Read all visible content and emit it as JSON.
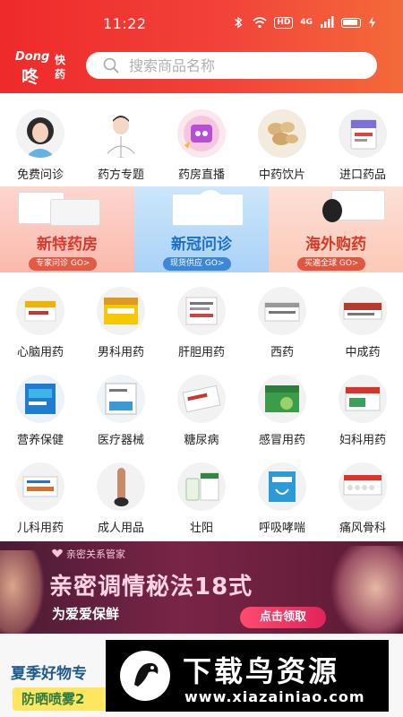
{
  "status_bar": {
    "time": "11:22",
    "hd": "HD",
    "net": "4G"
  },
  "header": {
    "logo": {
      "top": "Dong",
      "main": "咚",
      "right_top": "快",
      "right_bottom": "药"
    },
    "search_placeholder": "搜索商品名称"
  },
  "categories_row1": [
    {
      "label": "免费问诊",
      "icon": "doctor-avatar-icon"
    },
    {
      "label": "药方专题",
      "icon": "doctor-icon"
    },
    {
      "label": "药房直播",
      "icon": "live-icon"
    },
    {
      "label": "中药饮片",
      "icon": "herb-slices-icon"
    },
    {
      "label": "进口药品",
      "icon": "imported-medicine-icon"
    }
  ],
  "banners": [
    {
      "title": "新特药房",
      "sub": "专家问诊 GO>",
      "color": "#e8504a"
    },
    {
      "title": "新冠问诊",
      "sub": "现货供应 GO>",
      "color": "#2e7fd6"
    },
    {
      "title": "海外购药",
      "sub": "买遍全球 GO>",
      "color": "#e0503e"
    }
  ],
  "categories_row2": [
    {
      "label": "心脑用药",
      "icon": "heart-brain-medicine-icon"
    },
    {
      "label": "男科用药",
      "icon": "male-medicine-icon"
    },
    {
      "label": "肝胆用药",
      "icon": "liver-medicine-icon"
    },
    {
      "label": "西药",
      "icon": "western-medicine-icon"
    },
    {
      "label": "中成药",
      "icon": "chinese-medicine-icon"
    }
  ],
  "categories_row3": [
    {
      "label": "营养保健",
      "icon": "nutrition-icon"
    },
    {
      "label": "医疗器械",
      "icon": "medical-device-icon"
    },
    {
      "label": "糖尿病",
      "icon": "diabetes-icon"
    },
    {
      "label": "感冒用药",
      "icon": "cold-medicine-icon"
    },
    {
      "label": "妇科用药",
      "icon": "gynecology-icon"
    }
  ],
  "categories_row4": [
    {
      "label": "儿科用药",
      "icon": "pediatric-icon"
    },
    {
      "label": "成人用品",
      "icon": "adult-products-icon"
    },
    {
      "label": "壮阳",
      "icon": "vitality-icon"
    },
    {
      "label": "呼吸哮喘",
      "icon": "respiratory-icon"
    },
    {
      "label": "痛风骨科",
      "icon": "gout-orthopedic-icon"
    }
  ],
  "promo": {
    "brand": "亲密关系管家",
    "headline": "亲密调情秘法18式",
    "sub": "为爱爱保鲜",
    "button": "点击领取"
  },
  "bottom_banner": {
    "title": "夏季好物专",
    "tag": "防晒喷雾2"
  },
  "watermark": {
    "text": "下载鸟资源",
    "url": "www.xiazainiao.com"
  },
  "colors": {
    "brand_red": "#ee2a2a",
    "accent_orange": "#f46a3a"
  }
}
